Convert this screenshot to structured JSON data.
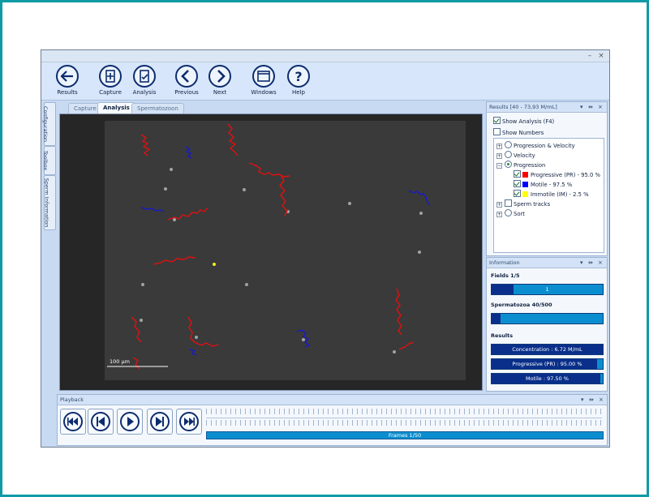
{
  "window_controls": {
    "minimize": "–",
    "close": "×"
  },
  "toolbar": {
    "results": "Results",
    "capture": "Capture",
    "analysis": "Analysis",
    "previous": "Previous",
    "next": "Next",
    "windows": "Windows",
    "help": "Help"
  },
  "side_tabs": {
    "configuration": "Configuration",
    "toolbox": "Toolbox",
    "sperm_information": "Sperm Information"
  },
  "doc_tabs": {
    "capture": "Capture",
    "analysis": "Analysis",
    "spermatozoon": "Spermatozoon"
  },
  "viewer": {
    "scale_label": "100 µm"
  },
  "results_panel": {
    "title": "Results [40 - 73,93 M/mL]",
    "show_analysis": "Show Analysis (F4)",
    "show_numbers": "Show Numbers",
    "tree": {
      "progression_velocity": "Progression & Velocity",
      "velocity": "Velocity",
      "progression": "Progression",
      "progressive": "Progressive (PR) - 95.0 %",
      "motile": "Motile - 97.5 %",
      "immotile": "Immotile (IM) - 2.5 %",
      "sperm_tracks": "Sperm tracks",
      "sort": "Sort"
    },
    "colors": {
      "progressive": "#ff0000",
      "motile": "#0000ff",
      "immotile": "#ffff00"
    }
  },
  "info_panel": {
    "title": "Information",
    "fields_label": "Fields 1/5",
    "fields_bar": "1",
    "fields_fraction": 0.2,
    "spermatozoa_label": "Spermatozoa 40/500",
    "spermatozoa_fraction": 0.08,
    "results_label": "Results",
    "concentration": "Concentration : 6.72 M/mL",
    "progressive": "Progressive (PR) : 95.00 %",
    "progressive_fraction": 0.95,
    "motile": "Motile : 97.50 %",
    "motile_fraction": 0.975
  },
  "playback": {
    "title": "Playback",
    "frames": "Frames 1/50"
  }
}
